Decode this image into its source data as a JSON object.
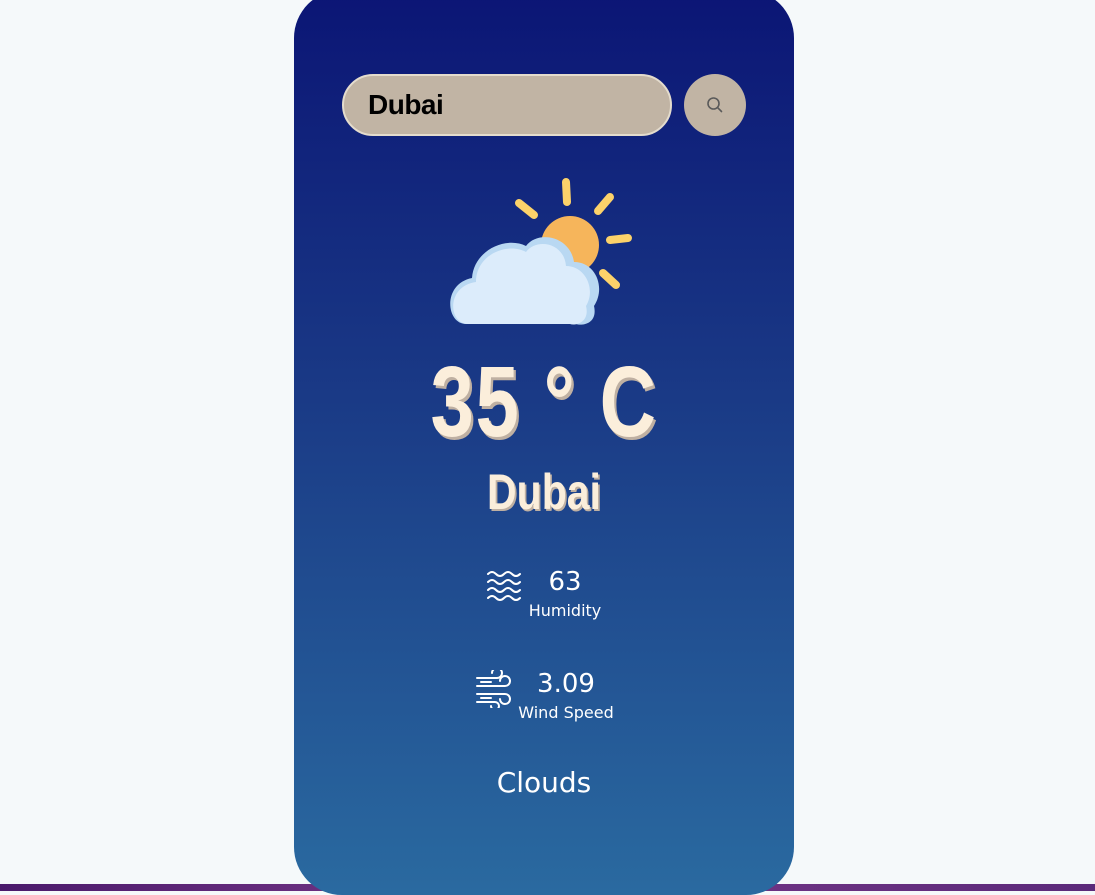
{
  "search": {
    "value": "Dubai",
    "button_icon": "search-icon"
  },
  "weather": {
    "icon": "partly-cloudy-icon",
    "temperature": "35 ° C",
    "city": "Dubai",
    "condition": "Clouds"
  },
  "humidity": {
    "icon": "humidity-waves-icon",
    "value": "63",
    "label": "Humidity"
  },
  "wind": {
    "icon": "wind-icon",
    "value": "3.09",
    "label": "Wind Speed"
  },
  "colors": {
    "page_background": "#f5f9fa",
    "card_top": "#0b1575",
    "card_bottom": "#2a6aa0",
    "search_background": "#c1b4a4",
    "accent_text": "#fbeedb"
  }
}
